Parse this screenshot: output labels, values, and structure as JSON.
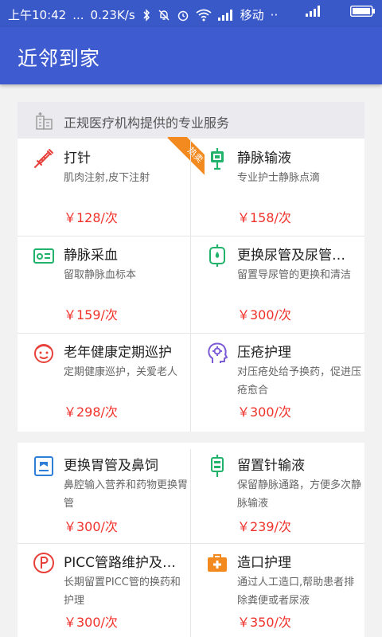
{
  "status_bar": {
    "time": "上午10:42",
    "dots": "...",
    "speed": "0.23K/s",
    "carrier": "移动",
    "carrier_dots": "··"
  },
  "app": {
    "title": "近邻到家"
  },
  "section": {
    "header": "正规医疗机构提供的专业服务"
  },
  "badges": {
    "hot": "热卖"
  },
  "services": [
    {
      "name": "打针",
      "desc": "肌肉注射,皮下注射",
      "price": "￥128/次"
    },
    {
      "name": "静脉输液",
      "desc": "专业护士静脉点滴",
      "price": "￥158/次"
    },
    {
      "name": "静脉采血",
      "desc": "留取静脉血标本",
      "price": "￥159/次"
    },
    {
      "name": "更换尿管及尿管维护",
      "desc": "留置导尿管的更换和清洁",
      "price": "￥300/次"
    },
    {
      "name": "老年健康定期巡护",
      "desc": "定期健康巡护，关爱老人",
      "price": "￥298/次"
    },
    {
      "name": "压疮护理",
      "desc": "对压疮处给予换药，促进压疮愈合",
      "price": "￥300/次"
    },
    {
      "name": "更换胃管及鼻饲",
      "desc": "鼻腔输入营养和药物更换胃管",
      "price": "￥300/次"
    },
    {
      "name": "留置针输液",
      "desc": "保留静脉通路，方便多次静脉输液",
      "price": "￥239/次"
    },
    {
      "name": "PICC管路维护及换...",
      "desc": "长期留置PICC管的换药和护理",
      "price": "￥300/次"
    },
    {
      "name": "造口护理",
      "desc": "通过人工造口,帮助患者排除粪便或者尿液",
      "price": "￥350/次"
    }
  ],
  "colors": {
    "primary": "#3f5bd0",
    "price": "#f0312a",
    "badge": "#f28a1f"
  }
}
